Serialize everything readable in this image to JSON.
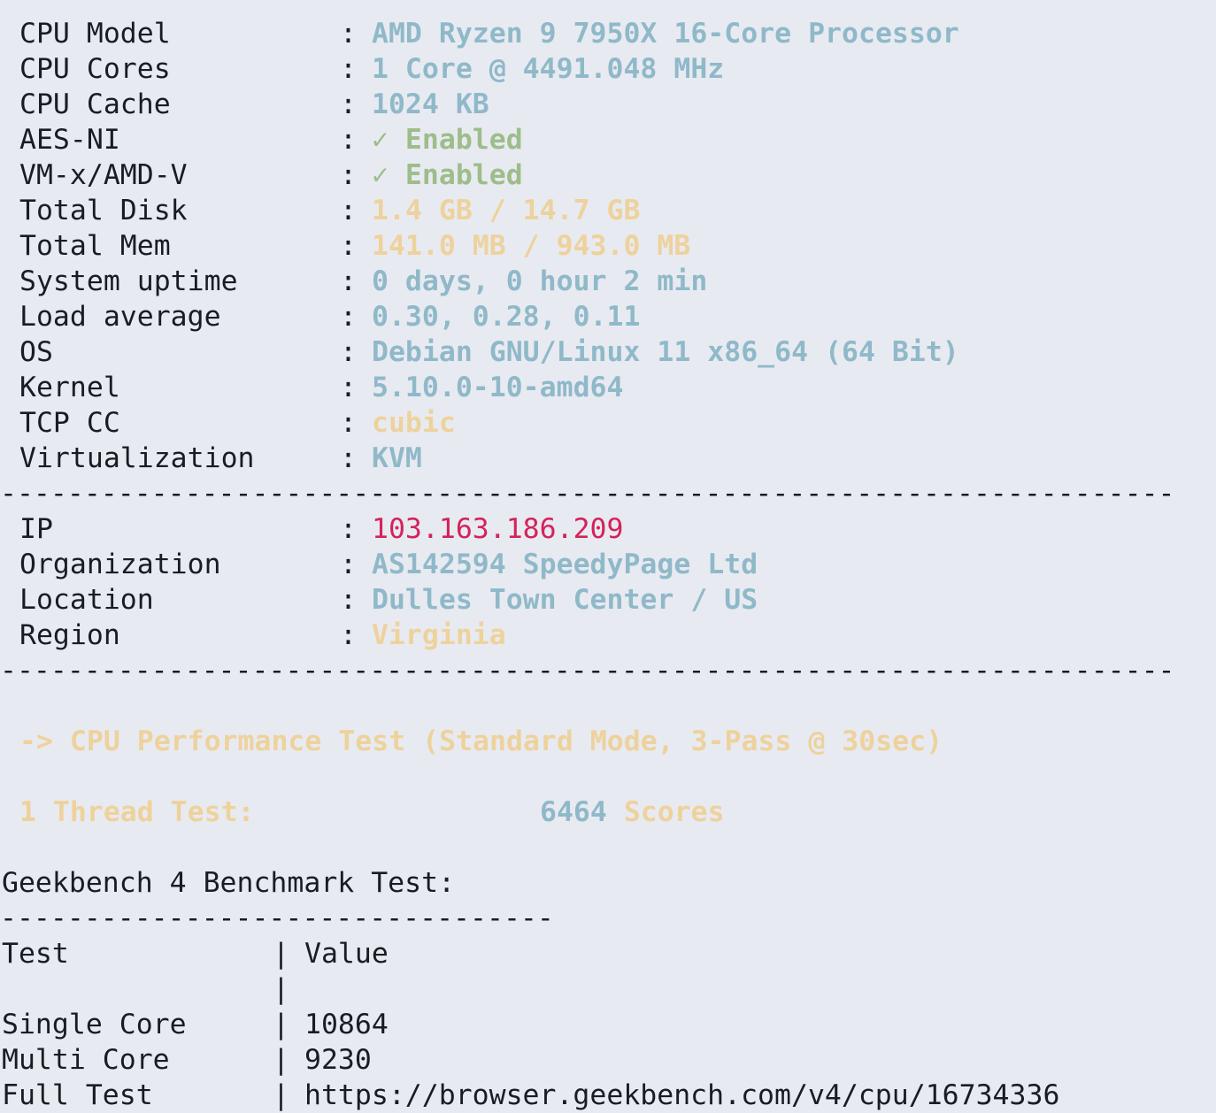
{
  "system": {
    "rows": [
      {
        "label": "CPU Model",
        "value": "AMD Ryzen 9 7950X 16-Core Processor",
        "color": "#8fb9c9"
      },
      {
        "label": "CPU Cores",
        "value": "1 Core @ 4491.048 MHz",
        "color": "#8fb9c9"
      },
      {
        "label": "CPU Cache",
        "value": "1024 KB",
        "color": "#8fb9c9"
      },
      {
        "label": "AES-NI",
        "value": "✓ Enabled",
        "color": "#9dbd8a"
      },
      {
        "label": "VM-x/AMD-V",
        "value": "✓ Enabled",
        "color": "#9dbd8a"
      },
      {
        "label": "Total Disk",
        "value": "1.4 GB / 14.7 GB",
        "color": "#eed29c"
      },
      {
        "label": "Total Mem",
        "value": "141.0 MB / 943.0 MB",
        "color": "#eed29c"
      },
      {
        "label": "System uptime",
        "value": "0 days, 0 hour 2 min",
        "color": "#8fb9c9"
      },
      {
        "label": "Load average",
        "value": "0.30, 0.28, 0.11",
        "color": "#8fb9c9"
      },
      {
        "label": "OS",
        "value": "Debian GNU/Linux 11 x86_64 (64 Bit)",
        "color": "#8fb9c9"
      },
      {
        "label": "Kernel",
        "value": "5.10.0-10-amd64",
        "color": "#8fb9c9"
      },
      {
        "label": "TCP CC",
        "value": "cubic",
        "color": "#eed29c"
      },
      {
        "label": "Virtualization",
        "value": "KVM",
        "color": "#8fb9c9"
      }
    ]
  },
  "separator": "----------------------------------------------------------------------",
  "network": {
    "rows": [
      {
        "label": "IP",
        "value": "103.163.186.209",
        "color": "#d4225a"
      },
      {
        "label": "Organization",
        "value": "AS142594 SpeedyPage Ltd",
        "color": "#8fb9c9"
      },
      {
        "label": "Location",
        "value": "Dulles Town Center / US",
        "color": "#8fb9c9"
      },
      {
        "label": "Region",
        "value": "Virginia",
        "color": "#eed29c"
      }
    ]
  },
  "colon": ":",
  "cpu_test": {
    "title": "-> CPU Performance Test (Standard Mode, 3-Pass @ 30sec)",
    "thread_label": "1 Thread Test:",
    "score_value": "6464",
    "score_unit": "Scores"
  },
  "geekbench": {
    "title": "Geekbench 4 Benchmark Test:",
    "separator": "---------------------------------",
    "pipe": "|",
    "header": {
      "test": "Test",
      "value": "Value"
    },
    "rows": [
      {
        "test": "",
        "value": ""
      },
      {
        "test": "Single Core",
        "value": "10864"
      },
      {
        "test": "Multi Core",
        "value": "9230"
      },
      {
        "test": "Full Test",
        "value": "https://browser.geekbench.com/v4/cpu/16734336"
      }
    ]
  }
}
